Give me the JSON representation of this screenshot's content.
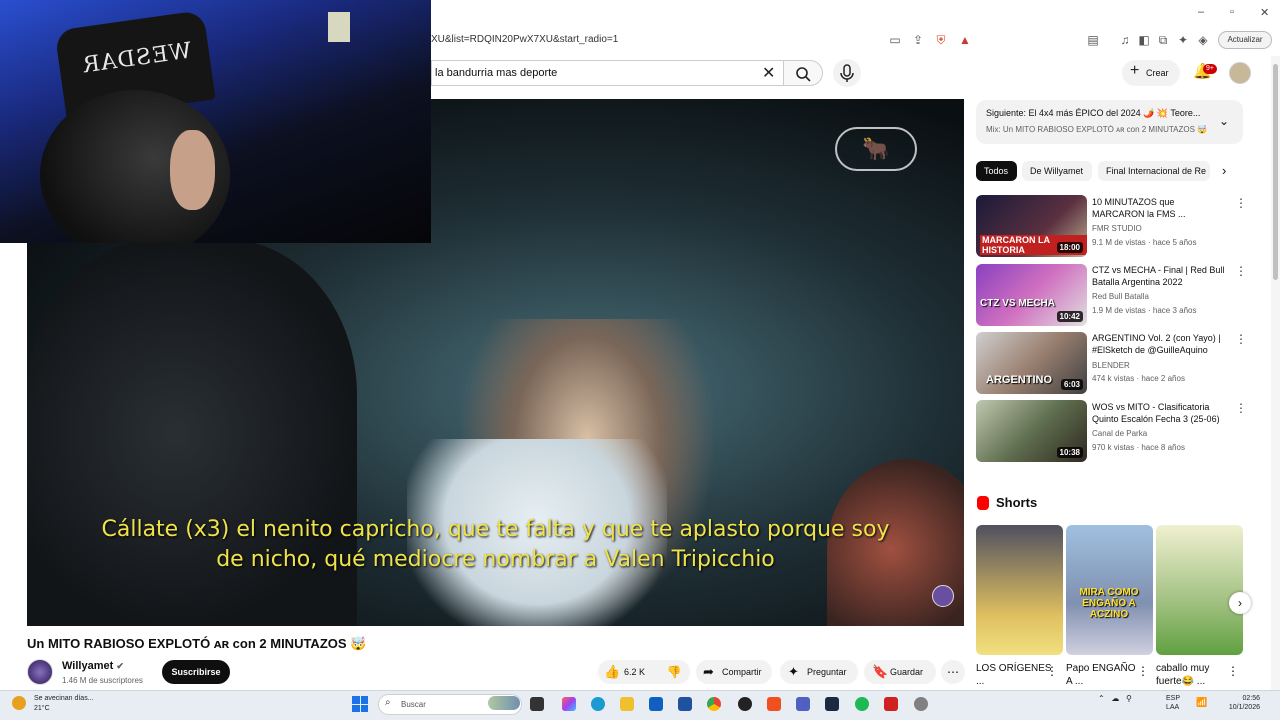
{
  "browser": {
    "url": "XU&list=RDQIN20PwX7XU&start_radio=1",
    "update_label": "Actualizar"
  },
  "search": {
    "value": "la bandurria mas deporte"
  },
  "header": {
    "create_label": "Crear",
    "notifications_badge": "9+"
  },
  "webcam": {
    "chair_brand": "WESDAR"
  },
  "video": {
    "subtitle_line1": "Cállate (x3) el nenito capricho, que te falta y que te aplasto porque soy",
    "subtitle_line2": "de nicho, qué mediocre nombrar a Valen Tripicchio",
    "title": "Un MITO RABIOSO EXPLOTÓ ᴀʀ con 2 MINUTAZOS 🤯"
  },
  "channel": {
    "name": "Willyamet",
    "subscribers": "1.46 M de suscriptores",
    "subscribe_label": "Suscribirse"
  },
  "actions": {
    "likes": "6.2 K",
    "share_label": "Compartir",
    "ask_label": "Preguntar",
    "save_label": "Guardar"
  },
  "next": {
    "line1": "Siguiente: El 4x4 más ÉPICO del 2024 🌶️ 💥 Teore...",
    "line2": "Mix: Un MITO RABIOSO EXPLOTÓ ᴀʀ con 2 MINUTAZOS 🤯"
  },
  "chips": [
    "Todos",
    "De Willyamet",
    "Final Internacional de Re"
  ],
  "recommendations": [
    {
      "title": "10 MINUTAZOS que MARCARON la FMS ...",
      "channel": "FMR STUDIO",
      "meta": "9.1 M de vistas · hace 5 años",
      "duration": "18:00",
      "thumb_text": "MARCARON LA HISTORIA"
    },
    {
      "title": "CTZ vs MECHA - Final | Red Bull Batalla Argentina 2022",
      "channel": "Red Bull Batalla",
      "meta": "1.9 M de vistas · hace 3 años",
      "duration": "10:42",
      "thumb_text": "CTZ VS MECHA"
    },
    {
      "title": "ARGENTINO Vol. 2 (con Yayo) | #ElSketch de @GuilleAquino",
      "channel": "BLENDER",
      "meta": "474 k vistas · hace 2 años",
      "duration": "6:03",
      "thumb_text": "ARGENTINO"
    },
    {
      "title": "WOS vs MITO - Clasificatoria Quinto Escalón Fecha 3 (25-06)",
      "channel": "Canal de Parka",
      "meta": "970 k vistas · hace 8 años",
      "duration": "10:38",
      "thumb_text": ""
    }
  ],
  "shorts": {
    "heading": "Shorts",
    "items": [
      {
        "title": "LOS ORÍGENES ...",
        "thumb_text": ""
      },
      {
        "title": "Papo ENGAÑO A ...",
        "thumb_text": "MIRA COMO ENGAÑO A ACZINO"
      },
      {
        "title": "caballo muy fuerte😂 ...",
        "thumb_text": ""
      }
    ]
  },
  "taskbar": {
    "weather_line1": "Se avecinan días...",
    "weather_line2": "21°C",
    "search_placeholder": "Buscar",
    "lang_line1": "ESP",
    "lang_line2": "LAA",
    "time": "02:56",
    "date": "10/1/2026"
  }
}
